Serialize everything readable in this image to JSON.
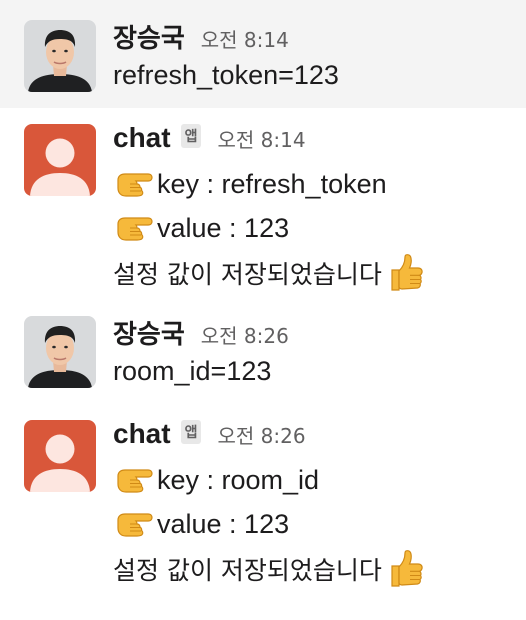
{
  "messages": [
    {
      "sender": "장승국",
      "time": "오전 8:14",
      "lines": [
        "refresh_token=123"
      ]
    },
    {
      "sender": "chat",
      "badge": "앱",
      "time": "오전 8:14",
      "lines": [
        "key : refresh_token",
        "value : 123",
        "설정 값이 저장되었습니다"
      ]
    },
    {
      "sender": "장승국",
      "time": "오전 8:26",
      "lines": [
        "room_id=123"
      ]
    },
    {
      "sender": "chat",
      "badge": "앱",
      "time": "오전 8:26",
      "lines": [
        "key : room_id",
        "value : 123",
        "설정 값이 저장되었습니다"
      ]
    }
  ],
  "colors": {
    "bot_avatar_bg": "#d9573a",
    "hover_bg": "#f4f4f4",
    "text": "#1d1c1d",
    "muted": "#616061"
  },
  "icons": {
    "pointing_hand": "backhand-index-pointing-right-icon",
    "thumbs_up": "thumbs-up-icon"
  }
}
